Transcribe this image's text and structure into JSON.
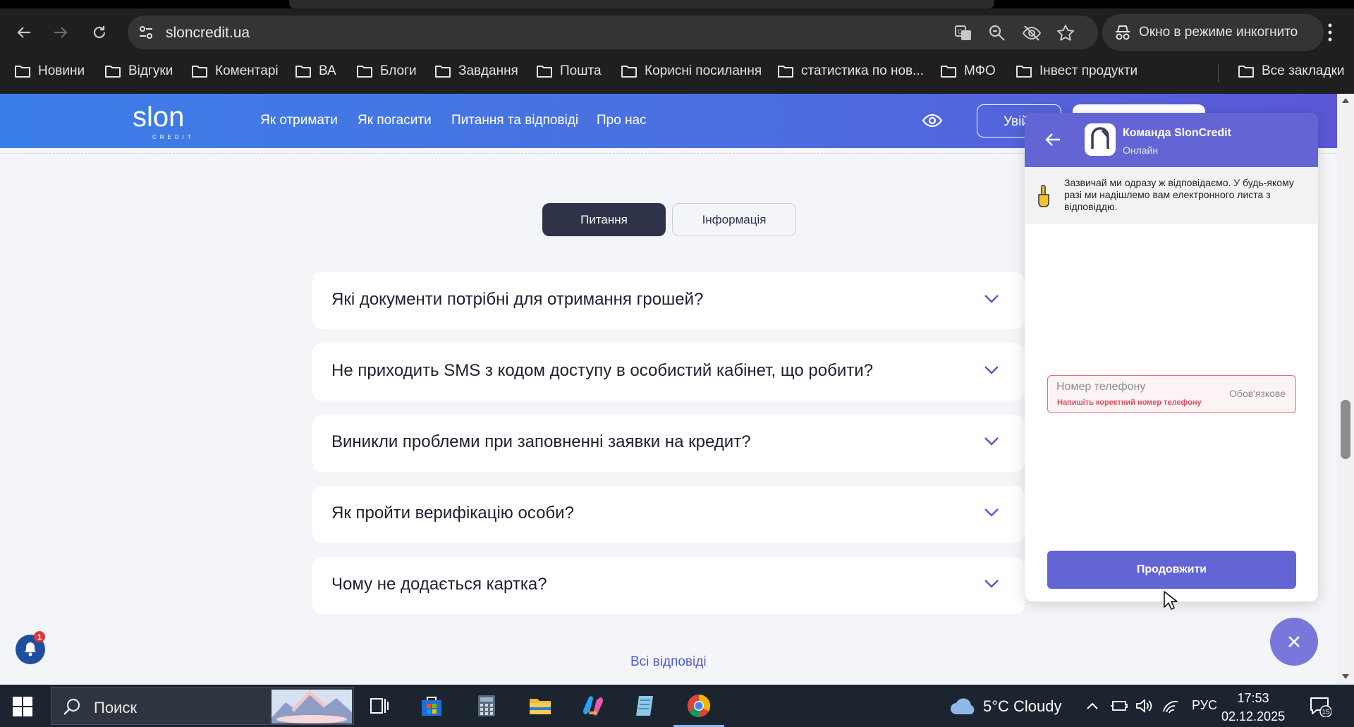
{
  "browser": {
    "url": "sloncredit.ua",
    "incognito_label": "Окно в режиме инкогнито",
    "bookmarks": [
      "Новини",
      "Відгуки",
      "Коментарі",
      "ВА",
      "Блоги",
      "Завдання",
      "Пошта",
      "Корисні посилання",
      "статистика по нов...",
      "МФО",
      "Інвест продукти"
    ],
    "all_bookmarks": "Все закладки"
  },
  "site": {
    "logo_text": "slon",
    "logo_sub": "CREDIT",
    "nav": [
      "Як отримати",
      "Як погасити",
      "Питання та відповіді",
      "Про нас"
    ],
    "login_label": "Увійти"
  },
  "faq": {
    "tabs": [
      "Питання",
      "Інформація"
    ],
    "active_tab": "Питання",
    "questions": [
      "Які документи потрібні для отримання грошей?",
      "Не приходить SMS з кодом доступу в особистий кабінет, що робити?",
      "Виникли проблеми при заповненні заявки на кредит?",
      "Як пройти верифікацію особи?",
      "Чому не додається картка?"
    ],
    "all_answers": "Всі відповіді"
  },
  "notifications": {
    "badge": "1"
  },
  "chat": {
    "title": "Команда SlonCredit",
    "status": "Онлайн",
    "notice": "Зазвичай ми одразу ж відповідаємо. У будь-якому разі ми надішлемо вам електронного листа з відповіддю.",
    "phone_placeholder": "Номер телефону",
    "required_label": "Обов'язкове",
    "error": "Напишіть коректний номер телефону",
    "continue_label": "Продовжити"
  },
  "taskbar": {
    "search_placeholder": "Поиск",
    "weather": "5°C  Cloudy",
    "language": "РУС",
    "time": "17:53",
    "date": "02.12.2025",
    "notif_count": "15"
  },
  "colors": {
    "header_start": "#3c7ee9",
    "header_end": "#5b57d6",
    "chat_accent": "#6465d4",
    "dark_tab": "#2f3349"
  }
}
